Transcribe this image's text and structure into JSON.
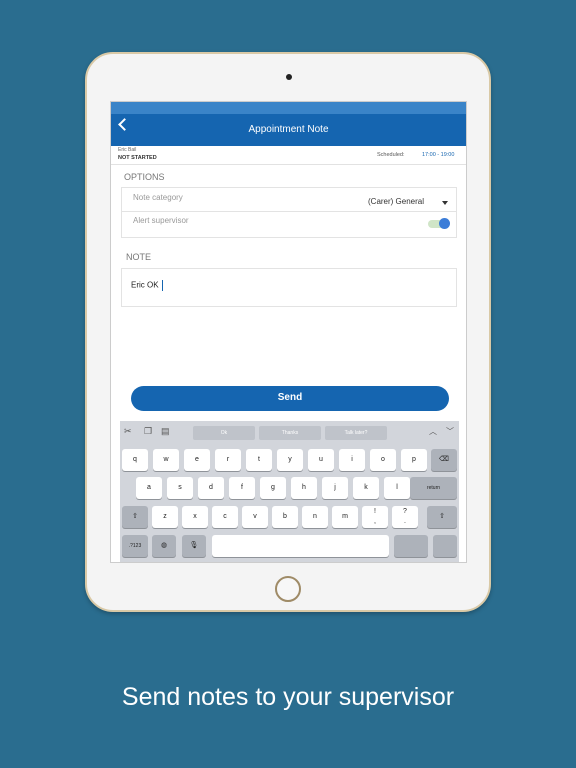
{
  "app": {
    "title": "Appointment Note"
  },
  "client": {
    "name": "Eric Bail",
    "status": "NOT STARTED",
    "scheduled_label": "Scheduled:",
    "scheduled_time": "17:00 - 19:00"
  },
  "options": {
    "heading": "OPTIONS",
    "note_category_label": "Note category",
    "note_category_value": "(Carer) General",
    "alert_supervisor_label": "Alert supervisor",
    "alert_supervisor_on": true
  },
  "note": {
    "heading": "NOTE",
    "value": "Eric OK"
  },
  "send_label": "Send",
  "keyboard": {
    "suggestions": [
      "Ok",
      "Thanks",
      "Talk later?"
    ],
    "row1": [
      "q",
      "w",
      "e",
      "r",
      "t",
      "y",
      "u",
      "i",
      "o",
      "p"
    ],
    "row2": [
      "a",
      "s",
      "d",
      "f",
      "g",
      "h",
      "j",
      "k",
      "l"
    ],
    "return_label": "return",
    "row3": [
      "z",
      "x",
      "c",
      "v",
      "b",
      "n",
      "m",
      "!\n,",
      "?\n."
    ],
    "numbers_label": ".?123"
  },
  "caption": "Send notes to your supervisor",
  "colors": {
    "background": "#2a6d8f",
    "accent": "#1565b0"
  }
}
